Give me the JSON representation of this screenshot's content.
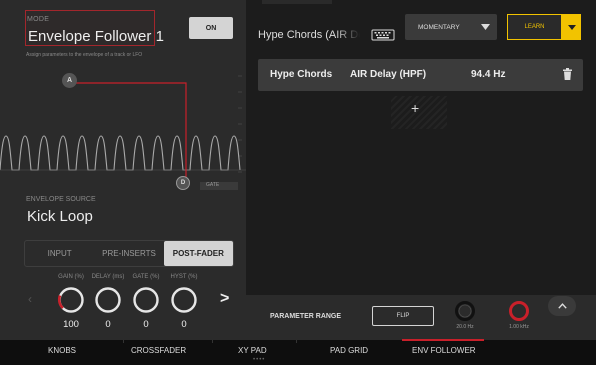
{
  "left": {
    "mode_label": "MODE",
    "mode_value": "Envelope Follower 1",
    "on_label": "ON",
    "assign_text": "Assign parameters to the envelope of a track or LFO",
    "marker_a": "A",
    "marker_d": "D",
    "gate_label": "GATE",
    "envelope_source_label": "ENVELOPE SOURCE",
    "envelope_source_value": "Kick Loop",
    "tabs": [
      {
        "label": "INPUT",
        "selected": false
      },
      {
        "label": "PRE-INSERTS",
        "selected": false
      },
      {
        "label": "POST-FADER",
        "selected": true
      }
    ],
    "knobs": [
      {
        "label": "GAIN (%)",
        "value": "100",
        "level": 0.4,
        "accent": true
      },
      {
        "label": "DELAY (ms)",
        "value": "0",
        "level": 0,
        "accent": false
      },
      {
        "label": "GATE (%)",
        "value": "0",
        "level": 0,
        "accent": false
      },
      {
        "label": "HYST (%)",
        "value": "0",
        "level": 0,
        "accent": false
      }
    ],
    "next_arrow": ">"
  },
  "right": {
    "track_title": "Hype Chords (AIR Delay (HPF))",
    "keyboard_icon": "keyboard-icon",
    "mode_dropdown": "MOMENTARY",
    "learn_label": "LEARN",
    "assignment": {
      "track": "Hype Chords",
      "parameter": "AIR Delay (HPF)",
      "value": "94.4 Hz"
    },
    "add_label": "+",
    "parameter_range_label": "PARAMETER RANGE",
    "flip_label": "FLIP",
    "range_knobs": [
      {
        "label": "20.0 Hz",
        "accent": false
      },
      {
        "label": "1.00 kHz",
        "accent": true
      }
    ]
  },
  "bottom_tabs": [
    {
      "label": "KNOBS",
      "active": false
    },
    {
      "label": "CROSSFADER",
      "active": false
    },
    {
      "label": "XY PAD",
      "active": false
    },
    {
      "label": "PAD GRID",
      "active": false
    },
    {
      "label": "ENV FOLLOWER",
      "active": true
    }
  ],
  "colors": {
    "accent_red": "#c8202a",
    "learn_yellow": "#f2c300",
    "panel_dark": "#2b2b2b",
    "panel_right": "#1c1c1c"
  }
}
